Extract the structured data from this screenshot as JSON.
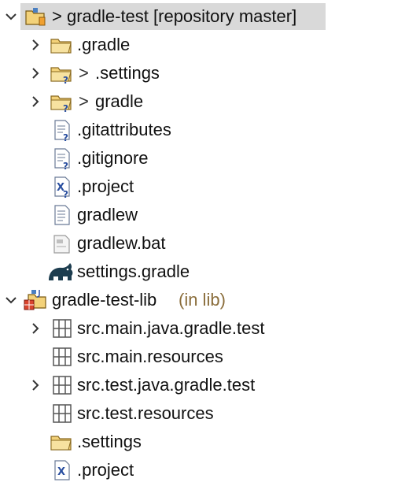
{
  "tree": {
    "items": [
      {
        "label": "> gradle-test [repository master]",
        "icon": "git-project-icon",
        "chevron": "down",
        "selected": true,
        "depth": 0
      },
      {
        "label": ".gradle",
        "icon": "folder-icon",
        "chevron": "right",
        "depth": 1
      },
      {
        "prefix": ">",
        "label": ".settings",
        "icon": "folder-unversioned-icon",
        "chevron": "right",
        "depth": 1
      },
      {
        "prefix": ">",
        "label": "gradle",
        "icon": "folder-unversioned-icon",
        "chevron": "right",
        "depth": 1
      },
      {
        "label": ".gitattributes",
        "icon": "file-unversioned-icon",
        "depth": 1
      },
      {
        "label": ".gitignore",
        "icon": "file-unversioned-icon",
        "depth": 1
      },
      {
        "label": ".project",
        "icon": "xml-file-unversioned-icon",
        "depth": 1
      },
      {
        "label": "gradlew",
        "icon": "file-icon",
        "depth": 1
      },
      {
        "label": "gradlew.bat",
        "icon": "bat-file-icon",
        "depth": 1
      },
      {
        "label": "settings.gradle",
        "icon": "gradle-elephant-icon",
        "depth": 1
      },
      {
        "label": "gradle-test-lib",
        "suffix": "(in lib)",
        "icon": "java-project-icon",
        "chevron": "down",
        "depth": 0
      },
      {
        "label": "src.main.java.gradle.test",
        "icon": "package-icon",
        "chevron": "right",
        "depth": 1
      },
      {
        "label": "src.main.resources",
        "icon": "package-icon",
        "depth": 1
      },
      {
        "label": "src.test.java.gradle.test",
        "icon": "package-icon",
        "chevron": "right",
        "depth": 1
      },
      {
        "label": "src.test.resources",
        "icon": "package-icon",
        "depth": 1
      },
      {
        "label": ".settings",
        "icon": "folder-icon",
        "depth": 1
      },
      {
        "label": ".project",
        "icon": "xml-file-icon",
        "depth": 1
      }
    ]
  },
  "colors": {
    "selection": "#d9d9d9",
    "folder": "#e8b84a",
    "suffix": "#8a6d3b"
  }
}
